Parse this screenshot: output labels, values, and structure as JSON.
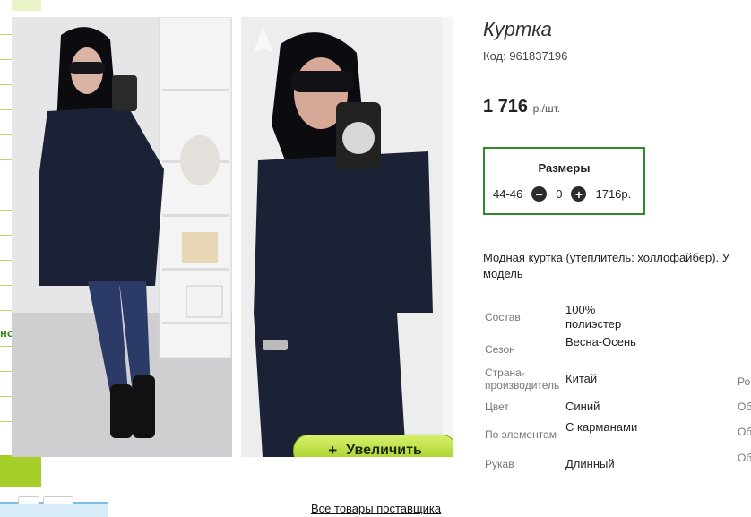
{
  "product": {
    "title": "Куртка",
    "code": "Код: 961837196",
    "price": "1 716",
    "price_unit": "р./шт."
  },
  "sizes": {
    "title": "Размеры",
    "rows": [
      {
        "size": "44-46",
        "minus": "−",
        "quantity": "0",
        "plus": "+",
        "price": "1716р."
      }
    ]
  },
  "description": "Модная куртка (утеплитель: холлофайбер). У",
  "description_line2": "модель",
  "attributes": [
    {
      "key": "Состав",
      "value": "100% полиэстер"
    },
    {
      "key": "Сезон",
      "value": "Весна-Осень"
    },
    {
      "key": "Страна-производитель",
      "value": "Китай"
    },
    {
      "key": "Цвет",
      "value": "Синий"
    },
    {
      "key": "По элементам",
      "value": "С карманами"
    },
    {
      "key": "Рукав",
      "value": "Длинный"
    }
  ],
  "attributes_right": [
    "Ро",
    "Об",
    "Об",
    "Об"
  ],
  "gallery": {
    "zoom_label": "Увеличить",
    "zoom_icon": "+"
  },
  "supplier_link": "Все товары поставщика",
  "left_tag": "но",
  "colors": {
    "accent_green": "#2f8a2a",
    "button_green": "#a6cf2a",
    "jacket_navy": "#1c2236"
  }
}
